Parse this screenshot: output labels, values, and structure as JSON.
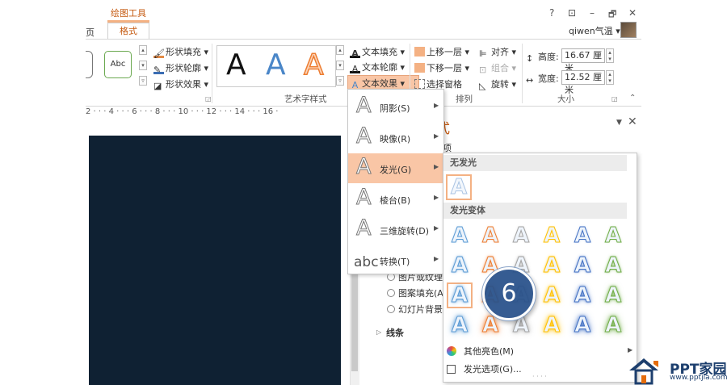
{
  "titlebar": {
    "contextual_tab_group": "绘图工具",
    "left_tab_fragment": "页",
    "active_tab": "格式",
    "help": "?",
    "restore_icon": "⊡",
    "minimize": "–",
    "maximize": "🗗",
    "close": "✕",
    "user": "qiwen气温 ▾"
  },
  "ribbon": {
    "abc": "Abc",
    "shape_fill": "形状填充",
    "shape_outline": "形状轮廓",
    "shape_effects": "形状效果",
    "wordart_styles": [
      "A",
      "A",
      "A"
    ],
    "text_fill": "文本填充",
    "text_outline": "文本轮廓",
    "text_effects": "文本效果",
    "wordart_group_label": "艺术字样式",
    "bring_forward": "上移一层",
    "send_backward": "下移一层",
    "selection_pane": "选择窗格",
    "align": "对齐",
    "group": "组合",
    "rotate": "旋转",
    "arrange_group_label": "排列",
    "height_label": "高度:",
    "height_value": "16.67 厘米",
    "width_label": "宽度:",
    "width_value": "12.52 厘米",
    "size_group_label": "大小"
  },
  "ruler": {
    "text": "2 · · · 4 · · · 6 · · · 8 · · · 10 · · · 12 · · · 14 · · · 16 ·"
  },
  "effects_menu": {
    "items": [
      {
        "label": "阴影(S)",
        "icon": "A"
      },
      {
        "label": "映像(R)",
        "icon": "A"
      },
      {
        "label": "发光(G)",
        "icon": "A"
      },
      {
        "label": "棱台(B)",
        "icon": "A"
      },
      {
        "label": "三维旋转(D)",
        "icon": "A"
      },
      {
        "label": "转换(T)",
        "icon": "abc"
      }
    ],
    "active_index": 2
  },
  "format_pane": {
    "title_fragment": "式",
    "subtitle_fragment": "项",
    "options": [
      "图片或纹理填",
      "图案填充(A)",
      "幻灯片背景填"
    ],
    "section": "线条"
  },
  "glow_gallery": {
    "no_glow_header": "无发光",
    "variants_header": "发光变体",
    "glyph": "A",
    "more_colors": "其他亮色(M)",
    "glow_options": "发光选项(G)...",
    "colors": [
      "#5b9bd5",
      "#ed7d31",
      "#a5a5a5",
      "#ffc000",
      "#4472c4",
      "#70ad47"
    ]
  },
  "step_badge": "6",
  "watermark": {
    "title": "PPT家园",
    "url": "www.pptjia.com"
  }
}
